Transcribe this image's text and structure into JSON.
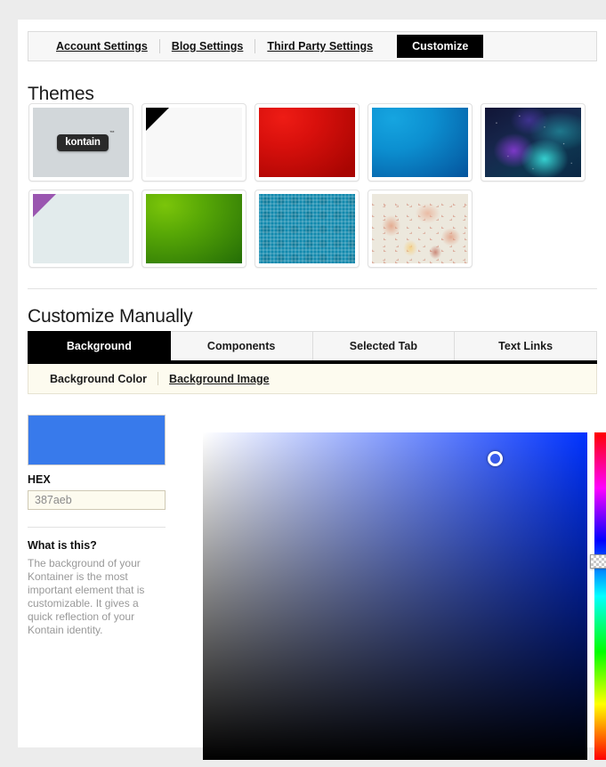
{
  "top_nav": {
    "links": [
      {
        "label": "Account Settings",
        "active": false
      },
      {
        "label": "Blog Settings",
        "active": false
      },
      {
        "label": "Third Party Settings",
        "active": false
      },
      {
        "label": "Customize",
        "active": true
      }
    ]
  },
  "themes": {
    "title": "Themes",
    "items": [
      {
        "name": "kontain-default-theme",
        "logo_text": "kontain",
        "trademark": "™"
      },
      {
        "name": "white-theme"
      },
      {
        "name": "red-theme"
      },
      {
        "name": "blue-theme"
      },
      {
        "name": "nebula-theme"
      },
      {
        "name": "pale-purple-theme"
      },
      {
        "name": "green-theme"
      },
      {
        "name": "teal-pattern-theme"
      },
      {
        "name": "floral-theme"
      }
    ]
  },
  "manual": {
    "title": "Customize Manually",
    "tabs": [
      {
        "label": "Background",
        "active": true
      },
      {
        "label": "Components",
        "active": false
      },
      {
        "label": "Selected Tab",
        "active": false
      },
      {
        "label": "Text Links",
        "active": false
      }
    ],
    "subtabs": [
      {
        "label": "Background Color",
        "active": true
      },
      {
        "label": "Background Image",
        "active": false
      }
    ]
  },
  "picker": {
    "preview_color": "#387aeb",
    "hex_label": "HEX",
    "hex_value": "387aeb",
    "hex_placeholder": "387aeb",
    "what_title": "What is this?",
    "what_body": "The background of your Kontainer is the most important element that is customizable. It gives a quick reflection of your Kontain identity."
  }
}
